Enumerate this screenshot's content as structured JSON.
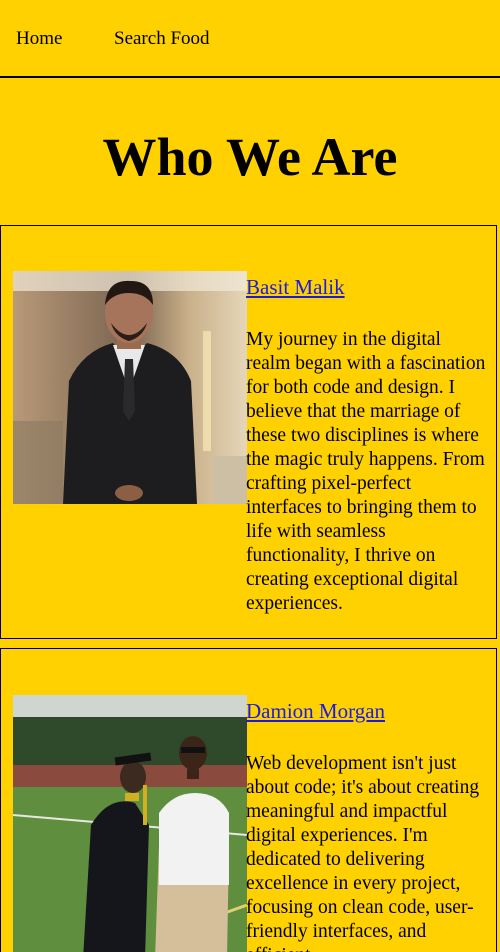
{
  "nav": {
    "items": [
      {
        "label": "Home"
      },
      {
        "label": "Search Food"
      }
    ]
  },
  "page_title": "Who We Are",
  "team": [
    {
      "name": "Basit Malik",
      "bio": "My journey in the digital realm began with a fascination for both code and design. I believe that the marriage of these two disciplines is where the magic truly happens. From crafting pixel-perfect interfaces to bringing them to life with seamless functionality, I thrive on creating exceptional digital experiences."
    },
    {
      "name": "Damion Morgan",
      "bio": "Web development isn't just about code; it's about creating meaningful and impactful digital experiences. I'm dedicated to delivering excellence in every project, focusing on clean code, user-friendly interfaces, and efficient"
    }
  ],
  "colors": {
    "background": "#FFD100",
    "link": "#1a1ae6",
    "border": "#000000"
  }
}
